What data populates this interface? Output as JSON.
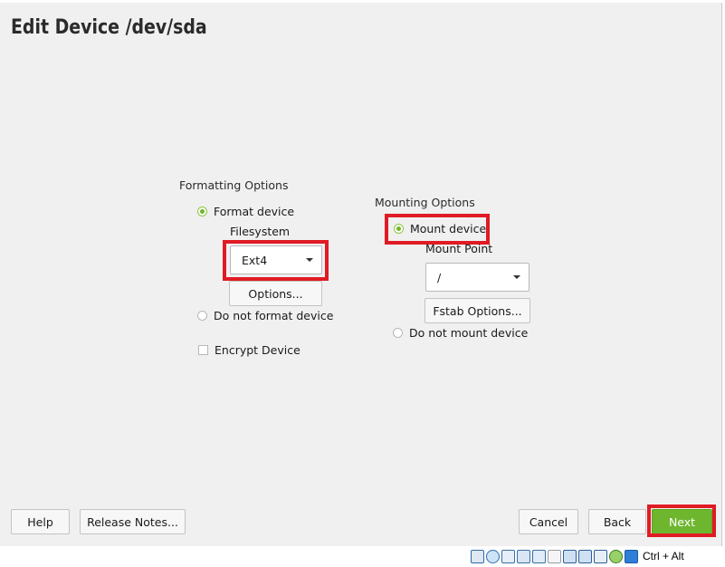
{
  "title": "Edit Device /dev/sda",
  "formatting": {
    "section_label": "Formatting Options",
    "format_device_label": "Format device",
    "format_device_selected": true,
    "filesystem_label": "Filesystem",
    "filesystem_value": "Ext4",
    "options_button": "Options...",
    "do_not_format_label": "Do not format device",
    "encrypt_label": "Encrypt Device",
    "encrypt_checked": false
  },
  "mounting": {
    "section_label": "Mounting Options",
    "mount_device_label": "Mount device",
    "mount_device_selected": true,
    "mount_point_label": "Mount Point",
    "mount_point_value": "/",
    "fstab_button": "Fstab Options...",
    "do_not_mount_label": "Do not mount device"
  },
  "footer": {
    "help": "Help",
    "release_notes": "Release Notes...",
    "cancel": "Cancel",
    "back": "Back",
    "next": "Next"
  },
  "status_bar": {
    "host_key": "Ctrl + Alt",
    "icons": [
      "hard-disk-icon",
      "optical-drive-icon",
      "audio-icon",
      "network-icon",
      "usb-icon",
      "shared-folder-icon",
      "display-icon",
      "video-capture-icon",
      "virtualization-icon",
      "mouse-integration-icon",
      "keyboard-capture-icon"
    ]
  },
  "colors": {
    "accent_green": "#6fb62f",
    "highlight_red": "#e01b24",
    "background": "#f0f0f0"
  }
}
